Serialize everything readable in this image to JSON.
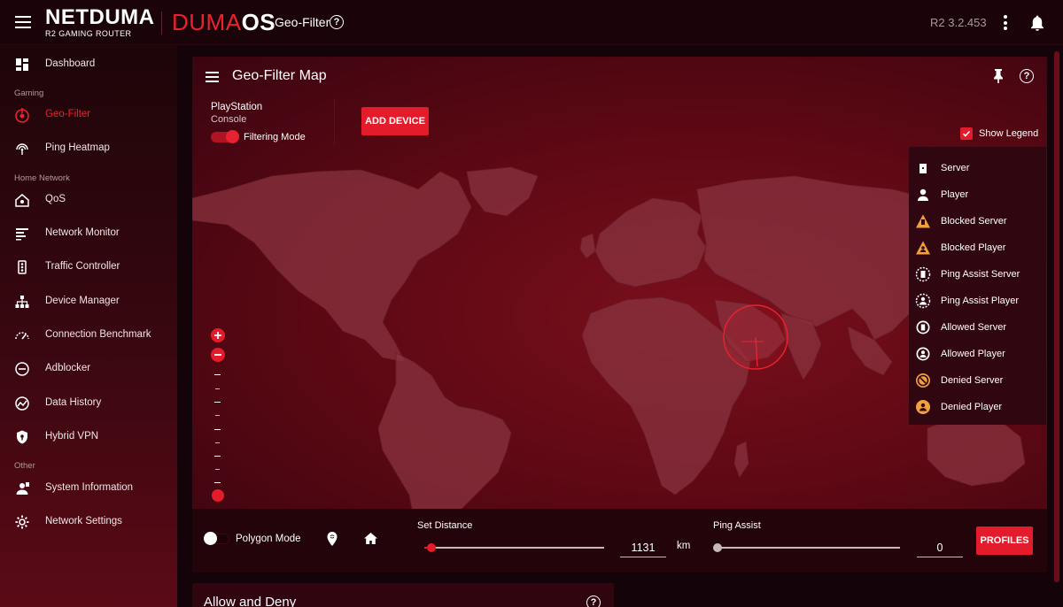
{
  "header": {
    "brand_main": "NETDUMA",
    "brand_sub": "R2 GAMING ROUTER",
    "os_duma": "DUMA",
    "os_os": "OS",
    "page": "Geo-Filter",
    "help_glyph": "?",
    "version": "R2 3.2.453"
  },
  "sidebar": {
    "items": [
      {
        "label": "Dashboard",
        "icon": "dashboard-icon"
      },
      {
        "label": "Geo-Filter",
        "icon": "geo-filter-icon"
      },
      {
        "label": "Ping Heatmap",
        "icon": "ping-heatmap-icon"
      },
      {
        "label": "QoS",
        "icon": "qos-icon"
      },
      {
        "label": "Network Monitor",
        "icon": "network-monitor-icon"
      },
      {
        "label": "Traffic Controller",
        "icon": "traffic-controller-icon"
      },
      {
        "label": "Device Manager",
        "icon": "device-manager-icon"
      },
      {
        "label": "Connection Benchmark",
        "icon": "connection-benchmark-icon"
      },
      {
        "label": "Adblocker",
        "icon": "adblocker-icon"
      },
      {
        "label": "Data History",
        "icon": "data-history-icon"
      },
      {
        "label": "Hybrid VPN",
        "icon": "hybrid-vpn-icon"
      },
      {
        "label": "System Information",
        "icon": "system-information-icon"
      },
      {
        "label": "Network Settings",
        "icon": "network-settings-icon"
      }
    ],
    "sections": {
      "gaming": "Gaming",
      "home": "Home Network",
      "other": "Other"
    },
    "active_color": "#e8232f"
  },
  "geo": {
    "title": "Geo-Filter Map",
    "device_name": "PlayStation",
    "device_type": "Console",
    "filtering_label": "Filtering Mode",
    "filtering_on": true,
    "add_device": "ADD DEVICE",
    "show_legend": "Show Legend",
    "show_legend_checked": true,
    "legend": [
      {
        "label": "Server",
        "icon": "server-icon"
      },
      {
        "label": "Player",
        "icon": "player-icon"
      },
      {
        "label": "Blocked Server",
        "icon": "blocked-server-icon"
      },
      {
        "label": "Blocked Player",
        "icon": "blocked-player-icon"
      },
      {
        "label": "Ping Assist Server",
        "icon": "ping-assist-server-icon"
      },
      {
        "label": "Ping Assist Player",
        "icon": "ping-assist-player-icon"
      },
      {
        "label": "Allowed Server",
        "icon": "allowed-server-icon"
      },
      {
        "label": "Allowed Player",
        "icon": "allowed-player-icon"
      },
      {
        "label": "Denied Server",
        "icon": "denied-server-icon"
      },
      {
        "label": "Denied Player",
        "icon": "denied-player-icon"
      }
    ],
    "zoom_level": 0,
    "polygon_mode_label": "Polygon Mode",
    "polygon_mode_on": false,
    "set_distance_label": "Set Distance",
    "distance_value": "1131",
    "distance_unit": "km",
    "ping_assist_label": "Ping Assist",
    "ping_assist_value": "0",
    "profiles": "PROFILES"
  },
  "allow_deny": {
    "title": "Allow and Deny"
  },
  "colors": {
    "accent": "#e31b2b",
    "legend_orange": "#f0a040"
  }
}
